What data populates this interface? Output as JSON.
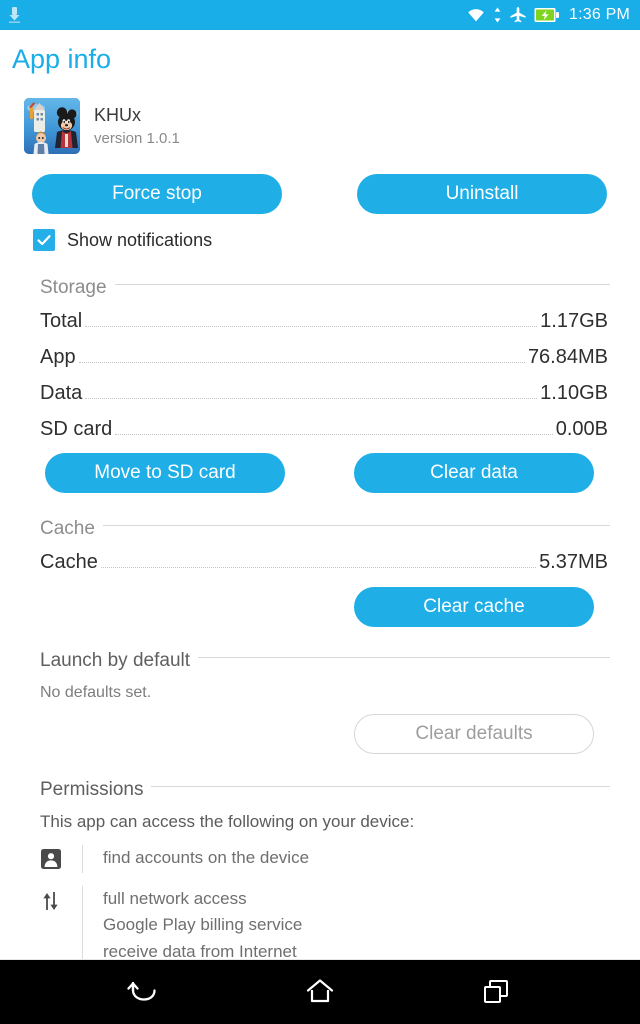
{
  "status_bar": {
    "background_color": "#19AEE8",
    "time": "1:36 PM",
    "left_icons": [
      "download-icon"
    ],
    "right_icons": [
      "wifi-icon",
      "data-transfer-icon",
      "airplane-mode-icon",
      "battery-charging-icon"
    ]
  },
  "page_title": "App info",
  "app": {
    "name": "KHUx",
    "version": "version 1.0.1",
    "icon_name": "khux-app-icon"
  },
  "primary_actions": {
    "force_stop": "Force stop",
    "uninstall": "Uninstall"
  },
  "notifications": {
    "label": "Show notifications",
    "checked": true
  },
  "storage": {
    "section_title": "Storage",
    "rows": [
      {
        "label": "Total",
        "value": "1.17GB"
      },
      {
        "label": "App",
        "value": "76.84MB"
      },
      {
        "label": "Data",
        "value": "1.10GB"
      },
      {
        "label": "SD card",
        "value": "0.00B"
      }
    ],
    "move_to_sd": "Move to SD card",
    "clear_data": "Clear data"
  },
  "cache": {
    "section_title": "Cache",
    "row": {
      "label": "Cache",
      "value": "5.37MB"
    },
    "clear_cache": "Clear cache"
  },
  "launch_by_default": {
    "section_title": "Launch by default",
    "note": "No defaults set.",
    "clear_defaults": "Clear defaults",
    "clear_defaults_disabled": true
  },
  "permissions": {
    "section_title": "Permissions",
    "intro": "This app can access the following on your device:",
    "groups": [
      {
        "icon_name": "account-person-icon",
        "lines": [
          "find accounts on the device"
        ]
      },
      {
        "icon_name": "network-transfer-icon",
        "lines": [
          "full network access",
          "Google Play billing service",
          "receive data from Internet"
        ]
      }
    ]
  },
  "nav_bar": {
    "background_color": "#000000",
    "buttons": [
      "back-icon",
      "home-icon",
      "recents-icon"
    ]
  },
  "colors": {
    "accent": "#19AEE8",
    "button": "#1FAEE6",
    "title": "#19AEE8",
    "section_header_text": "#8d8d8d",
    "body_text": "#2f2f2f",
    "muted_text": "#7d7d7d",
    "disabled_border": "#d6d6d6",
    "battery_green": "#7FD321"
  }
}
